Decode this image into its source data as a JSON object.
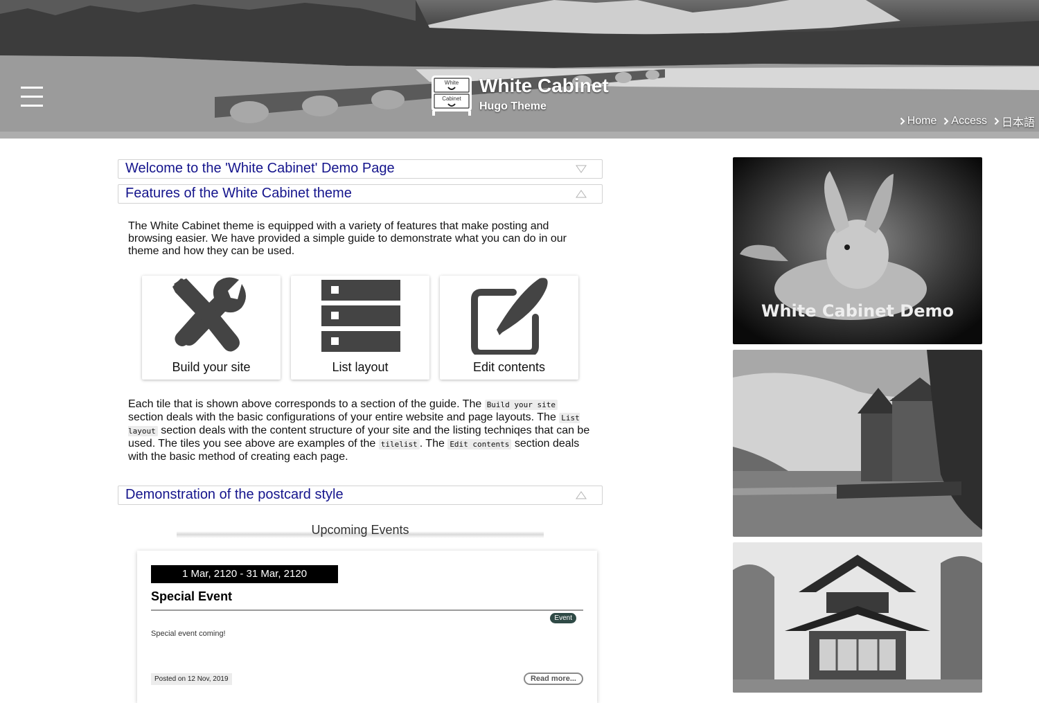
{
  "header": {
    "site_title": "White Cabinet",
    "site_subtitle": "Hugo Theme",
    "logo_text_top": "White",
    "logo_text_bottom": "Cabinet",
    "nav": [
      {
        "label": "Home"
      },
      {
        "label": "Access"
      },
      {
        "label": "日本語"
      }
    ]
  },
  "sections": [
    {
      "title": "Welcome to the 'White Cabinet' Demo Page",
      "state": "collapsed"
    },
    {
      "title": "Features of the White Cabinet theme",
      "state": "expanded"
    },
    {
      "title": "Demonstration of the postcard style",
      "state": "expanded"
    }
  ],
  "features": {
    "intro": "The White Cabinet theme is equipped with a variety of features that make posting and browsing easier. We have provided a simple guide to demonstrate what you can do in our theme and how they can be used.",
    "tiles": [
      {
        "label": "Build your site",
        "icon": "tools-icon"
      },
      {
        "label": "List layout",
        "icon": "list-layout-icon"
      },
      {
        "label": "Edit contents",
        "icon": "edit-icon"
      }
    ],
    "desc": {
      "p1": "Each tile that is shown above corresponds to a section of the guide. The ",
      "c1": "Build your site",
      "p2": " section deals with the basic configurations of your entire website and page layouts. The ",
      "c2": "List layout",
      "p3": " section deals with the content structure of your site and the listing techniqes that can be used. The tiles you see above are examples of the ",
      "c3": "tilelist",
      "p4": ". The ",
      "c4": "Edit contents",
      "p5": " section deals with the basic method of creating each page."
    }
  },
  "events": {
    "heading": "Upcoming Events",
    "card": {
      "date": "1 Mar, 2120 - 31 Mar, 2120",
      "title": "Special Event",
      "tag": "Event",
      "text": "Special event coming!",
      "posted": "Posted on 12 Nov, 2019",
      "read_more": "Read more..."
    }
  },
  "sidebar": {
    "banner_caption": "White Cabinet Demo"
  }
}
